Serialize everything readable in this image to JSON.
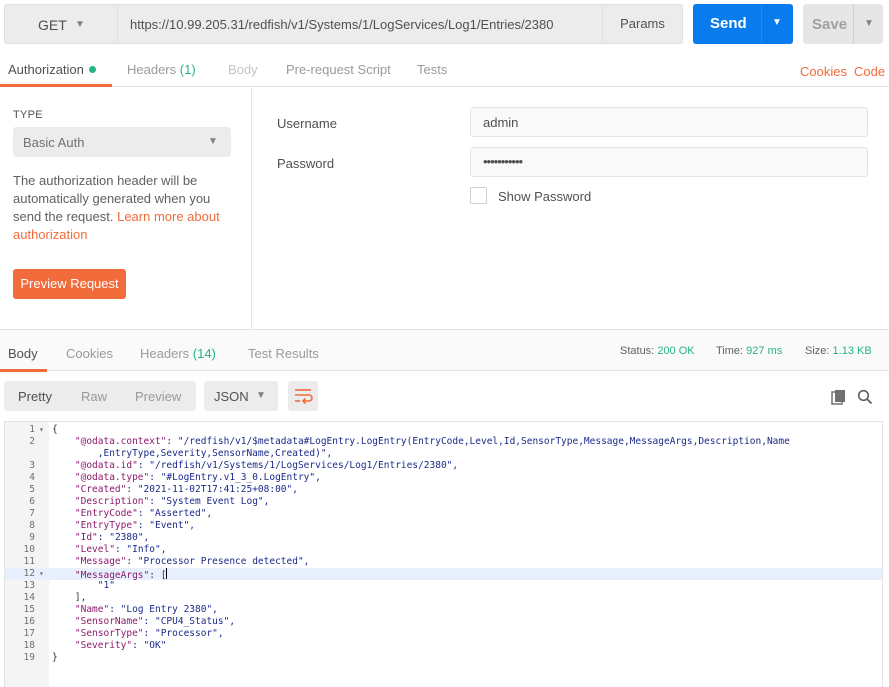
{
  "request": {
    "method": "GET",
    "url": "https://10.99.205.31/redfish/v1/Systems/1/LogServices/Log1/Entries/2380",
    "params_label": "Params",
    "send_label": "Send",
    "save_label": "Save"
  },
  "request_tabs": {
    "authorization": "Authorization",
    "headers": "Headers",
    "headers_count": "(1)",
    "body": "Body",
    "prerequest": "Pre-request Script",
    "tests": "Tests",
    "cookies": "Cookies",
    "code": "Code"
  },
  "auth": {
    "type_label": "TYPE",
    "type_value": "Basic Auth",
    "description": "The authorization header will be automatically generated when you send the request.",
    "learn_more": "Learn more about authorization",
    "preview_button": "Preview Request",
    "username_label": "Username",
    "username_value": "admin",
    "password_label": "Password",
    "password_value": "•••••••••••",
    "show_password_label": "Show Password"
  },
  "response_tabs": {
    "body": "Body",
    "cookies": "Cookies",
    "headers": "Headers",
    "headers_count": "(14)",
    "test_results": "Test Results"
  },
  "response_status": {
    "status_label": "Status:",
    "status_value": "200 OK",
    "time_label": "Time:",
    "time_value": "927 ms",
    "size_label": "Size:",
    "size_value": "1.13 KB"
  },
  "response_toolbar": {
    "pretty": "Pretty",
    "raw": "Raw",
    "preview": "Preview",
    "format": "JSON"
  },
  "response_body": {
    "lines": [
      {
        "num": "1",
        "fold": true,
        "key": "",
        "text": "{"
      },
      {
        "num": "2",
        "fold": false,
        "key": "\"@odata.context\"",
        "text": ": \"/redfish/v1/$metadata#LogEntry.LogEntry(EntryCode,Level,Id,SensorType,Message,MessageArgs,Description,Name"
      },
      {
        "num": "",
        "fold": false,
        "key": "",
        "text": "        ,EntryType,Severity,SensorName,Created)\","
      },
      {
        "num": "3",
        "fold": false,
        "key": "\"@odata.id\"",
        "text": ": \"/redfish/v1/Systems/1/LogServices/Log1/Entries/2380\","
      },
      {
        "num": "4",
        "fold": false,
        "key": "\"@odata.type\"",
        "text": ": \"#LogEntry.v1_3_0.LogEntry\","
      },
      {
        "num": "5",
        "fold": false,
        "key": "\"Created\"",
        "text": ": \"2021-11-02T17:41:25+08:00\","
      },
      {
        "num": "6",
        "fold": false,
        "key": "\"Description\"",
        "text": ": \"System Event Log\","
      },
      {
        "num": "7",
        "fold": false,
        "key": "\"EntryCode\"",
        "text": ": \"Asserted\","
      },
      {
        "num": "8",
        "fold": false,
        "key": "\"EntryType\"",
        "text": ": \"Event\","
      },
      {
        "num": "9",
        "fold": false,
        "key": "\"Id\"",
        "text": ": \"2380\","
      },
      {
        "num": "10",
        "fold": false,
        "key": "\"Level\"",
        "text": ": \"Info\","
      },
      {
        "num": "11",
        "fold": false,
        "key": "\"Message\"",
        "text": ": \"Processor Presence detected\","
      },
      {
        "num": "12",
        "fold": true,
        "key": "\"MessageArgs\"",
        "text": ": ["
      },
      {
        "num": "13",
        "fold": false,
        "key": "",
        "text": "        \"1\""
      },
      {
        "num": "14",
        "fold": false,
        "key": "",
        "text": "    ],"
      },
      {
        "num": "15",
        "fold": false,
        "key": "\"Name\"",
        "text": ": \"Log Entry 2380\","
      },
      {
        "num": "16",
        "fold": false,
        "key": "\"SensorName\"",
        "text": ": \"CPU4_Status\","
      },
      {
        "num": "17",
        "fold": false,
        "key": "\"SensorType\"",
        "text": ": \"Processor\","
      },
      {
        "num": "18",
        "fold": false,
        "key": "\"Severity\"",
        "text": ": \"OK\""
      },
      {
        "num": "19",
        "fold": false,
        "key": "",
        "text": "}"
      }
    ]
  },
  "colors": {
    "accent_orange": "#f26b3a",
    "send_blue": "#097bed",
    "success_green": "#26b47f"
  }
}
